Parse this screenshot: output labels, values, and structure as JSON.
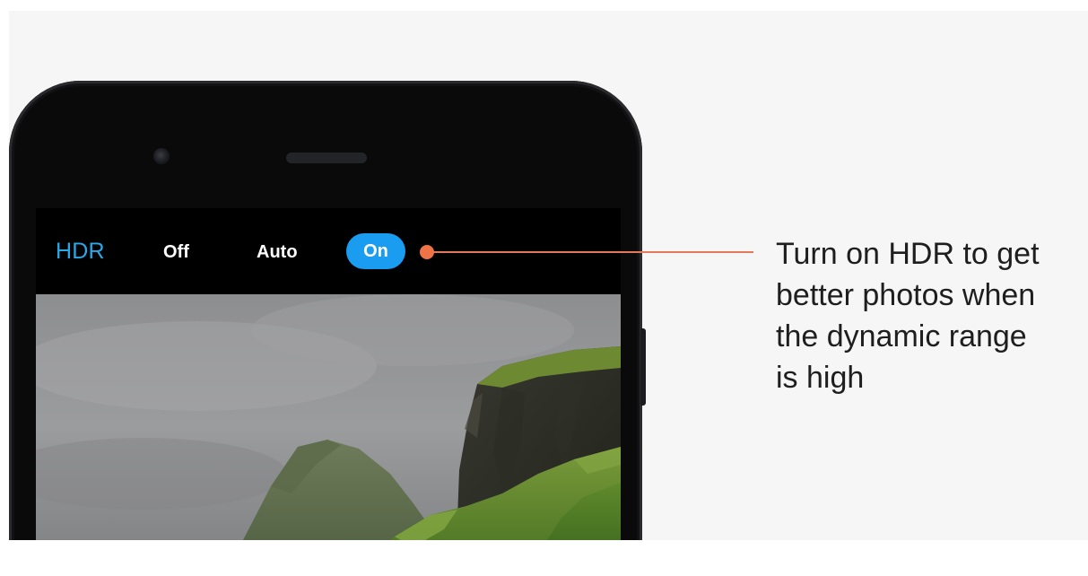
{
  "hdr_bar": {
    "label": "HDR",
    "options": {
      "off": "Off",
      "auto": "Auto",
      "on": "On"
    },
    "selected": "On"
  },
  "callout": {
    "lines": [
      "Turn on HDR to get",
      "better photos when",
      "the dynamic range",
      "is high"
    ]
  },
  "colors": {
    "accent_blue": "#1a9cf0",
    "hdr_label_blue": "#2aa7e8",
    "callout_orange": "#ee7346",
    "phone_body": "#0a0a0b",
    "background": "#f6f6f6"
  },
  "icons": {
    "front_camera": "front-camera-icon",
    "earpiece": "earpiece-speaker-icon"
  }
}
